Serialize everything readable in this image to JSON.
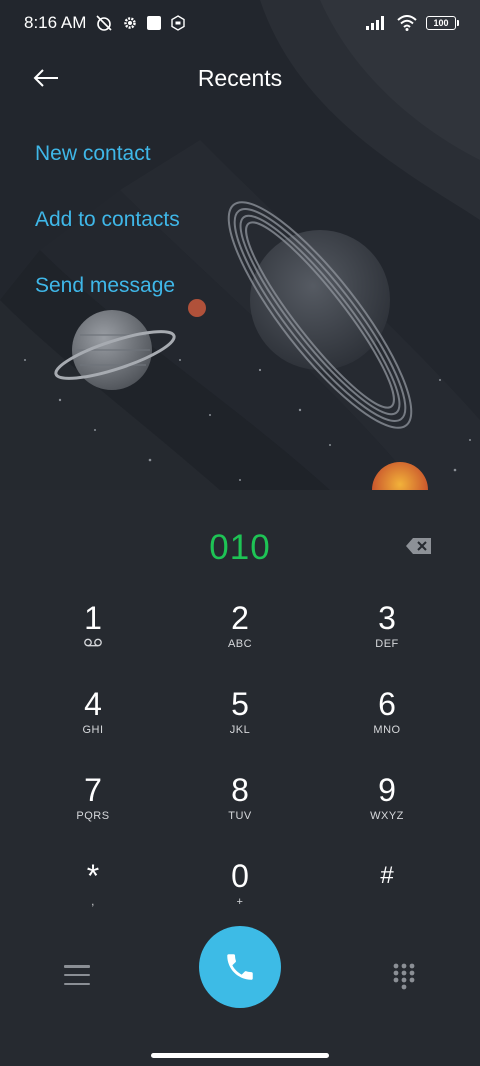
{
  "status_bar": {
    "time": "8:16 AM",
    "battery": "100",
    "icons": [
      "muted-alarm-icon",
      "settings-gear-icon",
      "square-notification-icon",
      "hexagon-app-icon",
      "signal-icon",
      "wifi-icon",
      "battery-icon"
    ]
  },
  "header": {
    "title": "Recents",
    "back_icon": "back-arrow-icon"
  },
  "actions": {
    "new_contact": "New contact",
    "add_to_contacts": "Add to contacts",
    "send_message": "Send message"
  },
  "dialer": {
    "number": "010",
    "number_color": "#1ec455",
    "backspace_icon": "backspace-icon"
  },
  "keypad": {
    "keys": [
      {
        "digit": "1",
        "letters": ""
      },
      {
        "digit": "2",
        "letters": "ABC"
      },
      {
        "digit": "3",
        "letters": "DEF"
      },
      {
        "digit": "4",
        "letters": "GHI"
      },
      {
        "digit": "5",
        "letters": "JKL"
      },
      {
        "digit": "6",
        "letters": "MNO"
      },
      {
        "digit": "7",
        "letters": "PQRS"
      },
      {
        "digit": "8",
        "letters": "TUV"
      },
      {
        "digit": "9",
        "letters": "WXYZ"
      },
      {
        "digit": "*",
        "letters": ","
      },
      {
        "digit": "0",
        "letters": "+"
      },
      {
        "digit": "#",
        "letters": ""
      }
    ]
  },
  "bottom_bar": {
    "menu_icon": "menu-icon",
    "call_icon": "phone-icon",
    "dialpad_icon": "dialpad-icon",
    "accent_color": "#3dbbe6"
  }
}
